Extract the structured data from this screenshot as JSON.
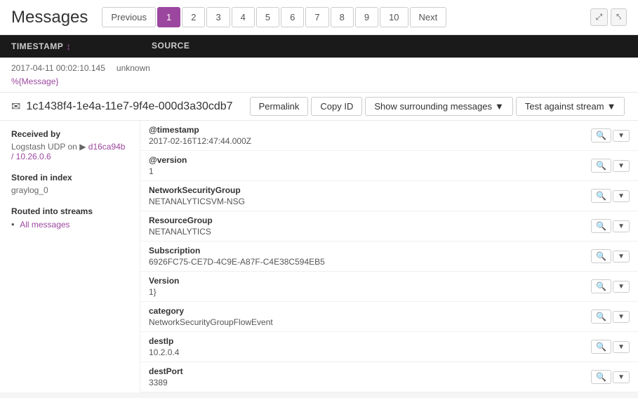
{
  "header": {
    "title": "Messages"
  },
  "pagination": {
    "previous_label": "Previous",
    "next_label": "Next",
    "pages": [
      "1",
      "2",
      "3",
      "4",
      "5",
      "6",
      "7",
      "8",
      "9",
      "10"
    ],
    "active_page": "1"
  },
  "table": {
    "col_timestamp": "Timestamp",
    "col_source": "source"
  },
  "message": {
    "timestamp": "2017-04-11 00:02:10.145",
    "source": "unknown",
    "link_text": "%{Message}",
    "id": "1c1438f4-1e4a-11e7-9f4e-000d3a30cdb7",
    "actions": {
      "permalink": "Permalink",
      "copy_id": "Copy ID",
      "surrounding": "Show surrounding messages",
      "test_stream": "Test against stream"
    }
  },
  "detail_left": {
    "received_by_title": "Received by",
    "received_by_value": "Logstash UDP on",
    "received_by_link": "d16ca94b / 10.26.0.6",
    "stored_title": "Stored in index",
    "stored_value": "graylog_0",
    "streams_title": "Routed into streams",
    "streams": [
      {
        "label": "All messages"
      }
    ]
  },
  "fields": [
    {
      "name": "@timestamp",
      "value": "2017-02-16T12:47:44.000Z"
    },
    {
      "name": "@version",
      "value": "1"
    },
    {
      "name": "NetworkSecurityGroup",
      "value": "NETANALYTICSVM-NSG"
    },
    {
      "name": "ResourceGroup",
      "value": "NETANALYTICS"
    },
    {
      "name": "Subscription",
      "value": "6926FC75-CE7D-4C9E-A87F-C4E38C594EB5"
    },
    {
      "name": "Version",
      "value": "1}"
    },
    {
      "name": "category",
      "value": "NetworkSecurityGroupFlowEvent"
    },
    {
      "name": "destIp",
      "value": "10.2.0.4"
    },
    {
      "name": "destPort",
      "value": "3389"
    }
  ]
}
